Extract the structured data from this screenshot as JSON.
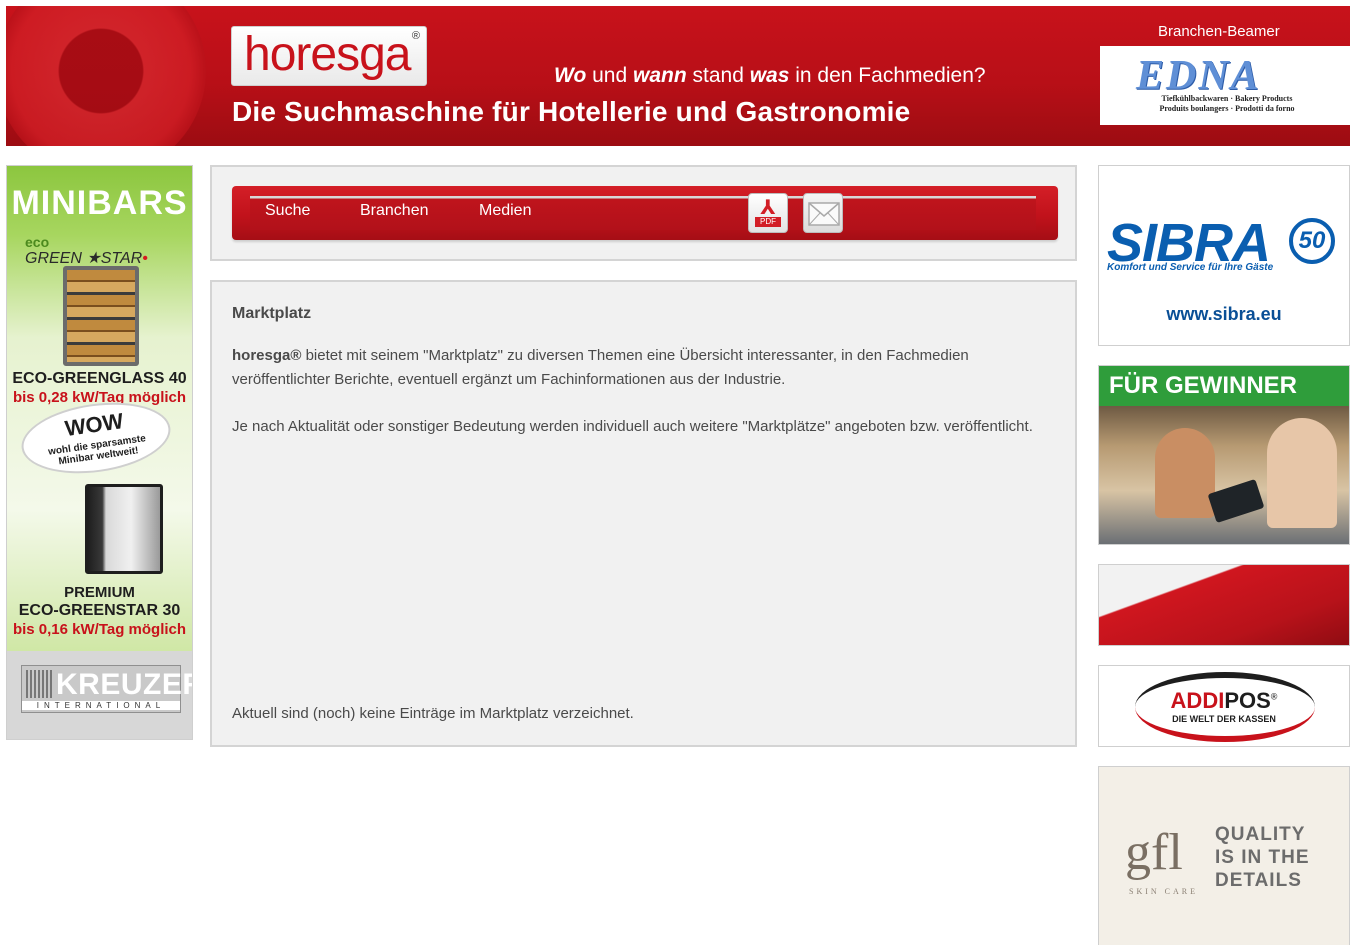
{
  "header": {
    "logo_text": "horesga",
    "logo_reg": "®",
    "tagline_parts": [
      "Wo",
      " und ",
      "wann",
      " stand ",
      "was",
      " in den Fachmedien?"
    ],
    "headline": "Die Suchmaschine für Hotellerie und Gastronomie",
    "beamer_label": "Branchen-Beamer",
    "edna": {
      "word": "EDNA",
      "sub1": "Tiefkühlbackwaren · Bakery Products",
      "sub2": "Produits boulangers · Prodotti da forno"
    }
  },
  "left_ad": {
    "title": "MINIBARS",
    "eco": "eco",
    "greenstar": "GREEN",
    "star": "STAR",
    "model1": "ECO-GREENGLASS 40",
    "model1_power": "bis 0,28 kW/Tag möglich",
    "wow": "WOW",
    "wow_sub1": "wohl die sparsamste",
    "wow_sub2": "Minibar weltweit!",
    "premium": "PREMIUM",
    "model2": "ECO-GREENSTAR 30",
    "model2_power": "bis 0,16 kW/Tag möglich",
    "brand": "KREUZER",
    "brand_sub": "INTERNATIONAL"
  },
  "nav": {
    "items": [
      {
        "label": "Suche"
      },
      {
        "label": "Branchen"
      },
      {
        "label": "Medien"
      }
    ],
    "pdf_label": "PDF"
  },
  "content": {
    "title": "Marktplatz",
    "para1_brand": "horesga®",
    "para1_text": " bietet mit seinem \"Marktplatz\" zu diversen Themen eine Übersicht interessanter, in den Fachmedien veröffentlichter Berichte, eventuell ergänzt um Fachinformationen aus der Industrie.",
    "para2": "Je nach Aktualität oder sonstiger Bedeutung werden individuell auch weitere \"Marktplätze\" angeboten bzw. veröffentlicht.",
    "empty_note": "Aktuell sind (noch) keine Einträge im Marktplatz verzeichnet."
  },
  "right_ads": {
    "sibra": {
      "word": "SIBRA",
      "badge": "50",
      "sub": "Komfort und Service für Ihre Gäste",
      "url": "www.sibra.eu"
    },
    "gewinner": {
      "title": "FÜR GEWINNER"
    },
    "addipos": {
      "part1": "ADDI",
      "part2": "POS",
      "reg": "®",
      "sub": "DIE WELT DER KASSEN"
    },
    "gfl": {
      "word": "gfl",
      "skin": "SKIN CARE",
      "q1": "QUALITY",
      "q2": "IS IN THE",
      "q3": "DETAILS"
    }
  },
  "colors": {
    "brand_red": "#c8121b",
    "panel_bg": "#f1f1f1",
    "text": "#4a4a4a"
  }
}
